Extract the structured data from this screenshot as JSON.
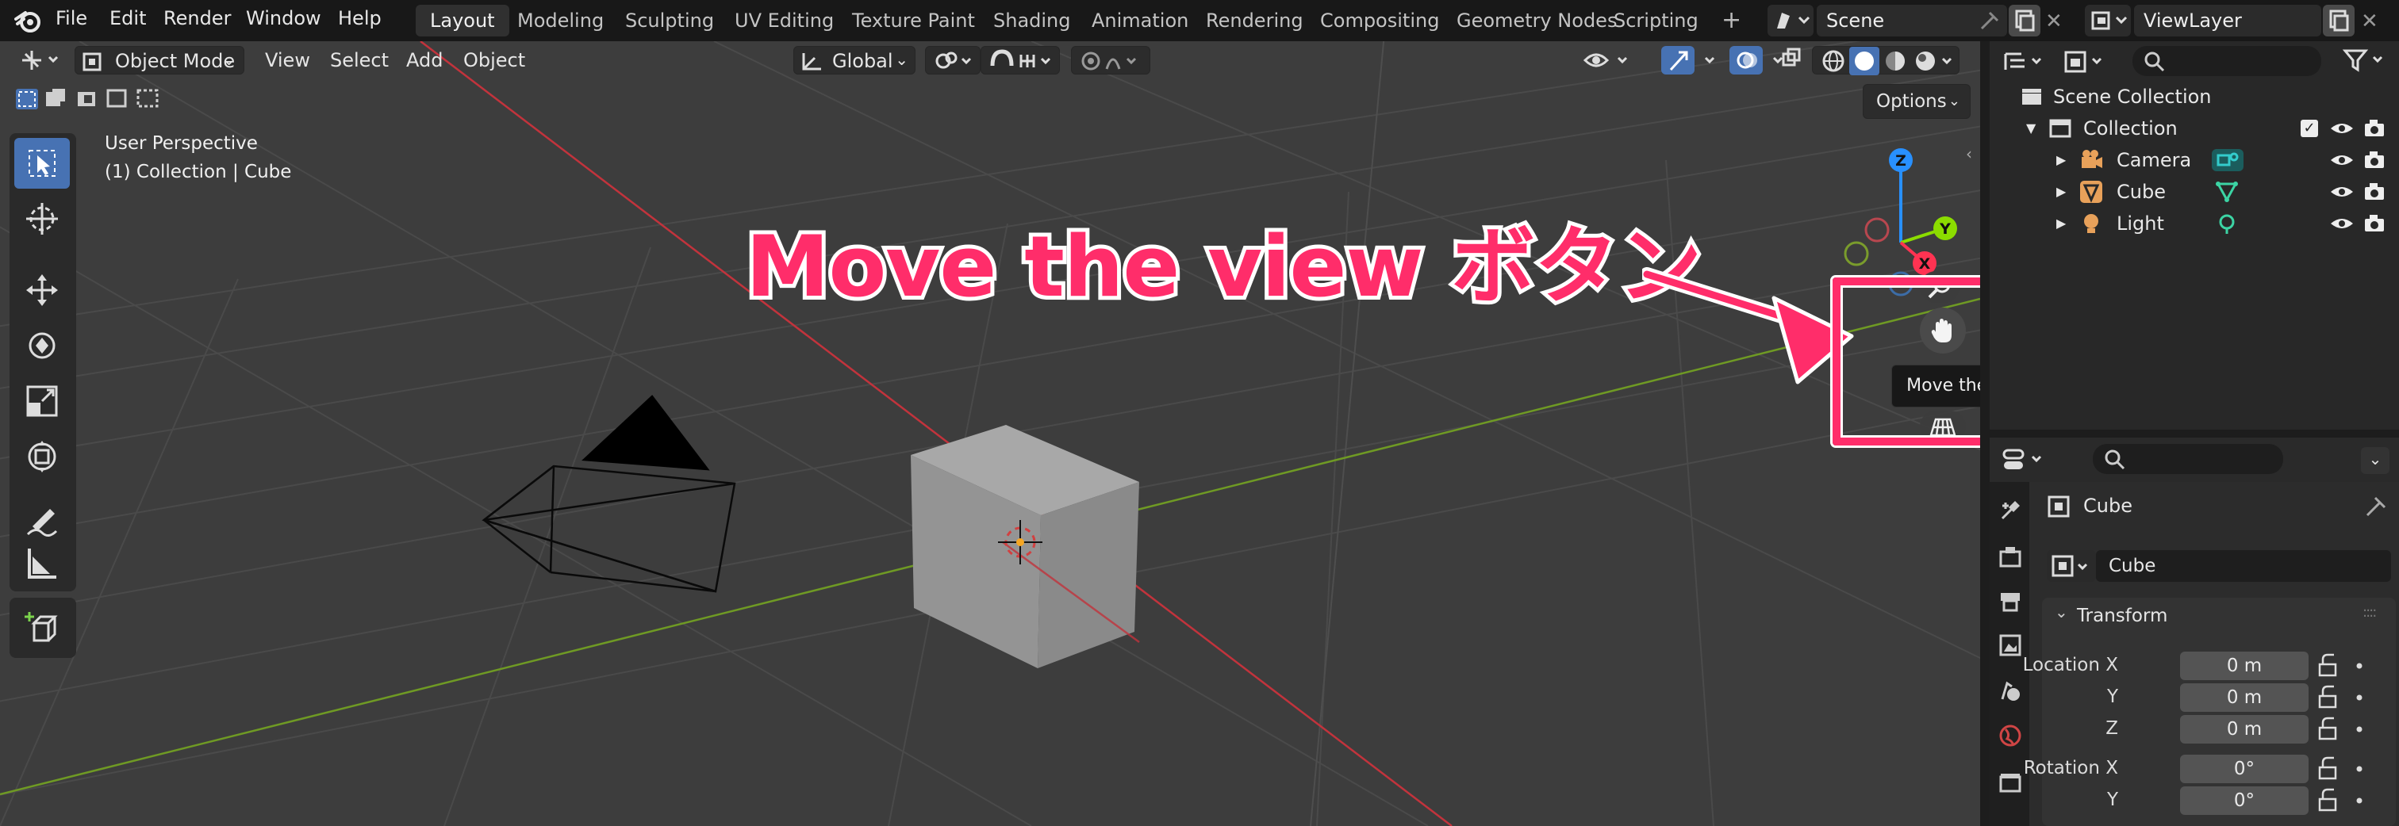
{
  "menu": [
    "File",
    "Edit",
    "Render",
    "Window",
    "Help"
  ],
  "workspaces": [
    "Layout",
    "Modeling",
    "Sculpting",
    "UV Editing",
    "Texture Paint",
    "Shading",
    "Animation",
    "Rendering",
    "Compositing",
    "Geometry Nodes",
    "Scripting"
  ],
  "scene_name": "Scene",
  "view_layer": "ViewLayer",
  "viewport_header": {
    "mode": "Object Mode",
    "menus": [
      "View",
      "Select",
      "Add",
      "Object"
    ],
    "orientation": "Global",
    "options": "Options"
  },
  "viewport_info": {
    "perspective": "User Perspective",
    "context": "(1) Collection | Cube"
  },
  "gizmo_axes": {
    "z": "Z",
    "y": "Y",
    "x": "X"
  },
  "annotation": {
    "title": "Move the view ボタン",
    "tooltip": "Move the view",
    "color": "#ff2d6a"
  },
  "outliner": {
    "root": "Scene Collection",
    "collection": "Collection",
    "items": [
      "Camera",
      "Cube",
      "Light"
    ]
  },
  "properties": {
    "object_name": "Cube",
    "data_name": "Cube",
    "panel": "Transform",
    "location_label": "Location X",
    "axis_y": "Y",
    "axis_z": "Z",
    "rotation_label": "Rotation X",
    "location_values": [
      "0 m",
      "0 m",
      "0 m"
    ],
    "rotation_values": [
      "0°",
      "0°"
    ]
  },
  "colors": {
    "accent": "#4772b3",
    "axis_x": "#ff3352",
    "axis_y": "#8bdc00",
    "axis_z": "#2890ff"
  }
}
